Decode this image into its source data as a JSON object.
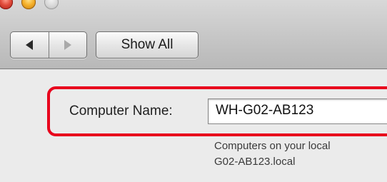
{
  "toolbar": {
    "traffic_lights": [
      {
        "name": "close",
        "color": "#e04a3a"
      },
      {
        "name": "minimize",
        "color": "#f5b02a"
      },
      {
        "name": "zoom",
        "color": "#d6d6d6"
      }
    ],
    "back_icon": "left-triangle",
    "forward_icon": "right-triangle",
    "show_all_label": "Show All"
  },
  "sharing": {
    "computer_name_label": "Computer Name:",
    "computer_name_value": "WH-G02-AB123",
    "description_line1": "Computers on your local",
    "description_line2": "G02-AB123.local"
  },
  "highlight_color": "#e8001c"
}
